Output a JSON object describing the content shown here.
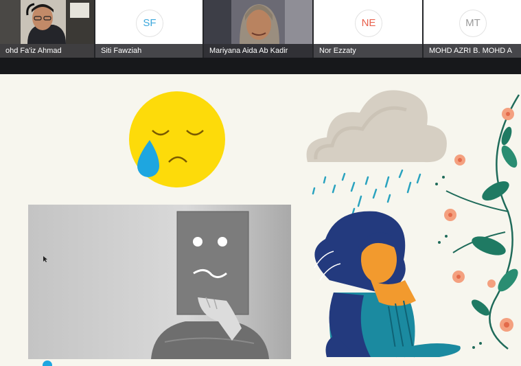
{
  "participants": [
    {
      "name": "ohd Fa'iz Ahmad",
      "initials": "",
      "has_video": true,
      "accent": ""
    },
    {
      "name": "Siti Fawziah",
      "initials": "SF",
      "has_video": false,
      "accent": "#3aa7dc"
    },
    {
      "name": "Mariyana Aida Ab Kadir",
      "initials": "",
      "has_video": true,
      "accent": ""
    },
    {
      "name": "Nor Ezzaty",
      "initials": "NE",
      "has_video": false,
      "accent": "#e8604c"
    },
    {
      "name": "MOHD AZRI B. MOHD A",
      "initials": "MT",
      "has_video": false,
      "accent": "#9a9a9a"
    }
  ],
  "shared_screen": {
    "illustrations": [
      "crying-face-emoji",
      "rain-cloud",
      "sad-face-paper-photo",
      "sad-girl-illustration",
      "floral-vine"
    ]
  }
}
